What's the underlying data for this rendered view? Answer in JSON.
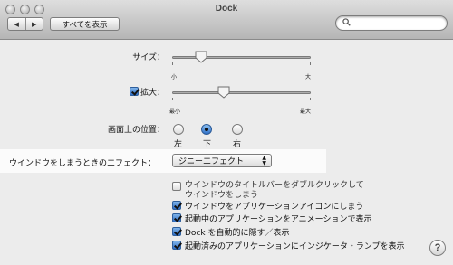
{
  "window": {
    "title": "Dock"
  },
  "toolbar": {
    "back_glyph": "◀",
    "forward_glyph": "▶",
    "show_all_label": "すべてを表示",
    "search_placeholder": ""
  },
  "size": {
    "label": "サイズ：",
    "value_fraction": 0.21,
    "min_label": "小",
    "max_label": "大"
  },
  "magnification": {
    "label": "拡大：",
    "checked": true,
    "value_fraction": 0.37,
    "min_label": "最小",
    "max_label": "最大"
  },
  "position": {
    "label": "画面上の位置：",
    "options": [
      {
        "label": "左",
        "selected": false
      },
      {
        "label": "下",
        "selected": true
      },
      {
        "label": "右",
        "selected": false
      }
    ]
  },
  "minimize_effect": {
    "label": "ウインドウをしまうときのエフェクト：",
    "value": "ジニーエフェクト"
  },
  "options": [
    {
      "label": "ウインドウのタイトルバーをダブルクリックして",
      "label2": "ウインドウをしまう",
      "checked": false
    },
    {
      "label": "ウインドウをアプリケーションアイコンにしまう",
      "checked": true
    },
    {
      "label": "起動中のアプリケーションをアニメーションで表示",
      "checked": true
    },
    {
      "label": "Dock を自動的に隠す／表示",
      "checked": true
    },
    {
      "label": "起動済みのアプリケーションにインジケータ・ランプを表示",
      "checked": true
    }
  ],
  "help_label": "?",
  "colors": {
    "accent": "#2f6dc4",
    "background": "#ececec"
  }
}
